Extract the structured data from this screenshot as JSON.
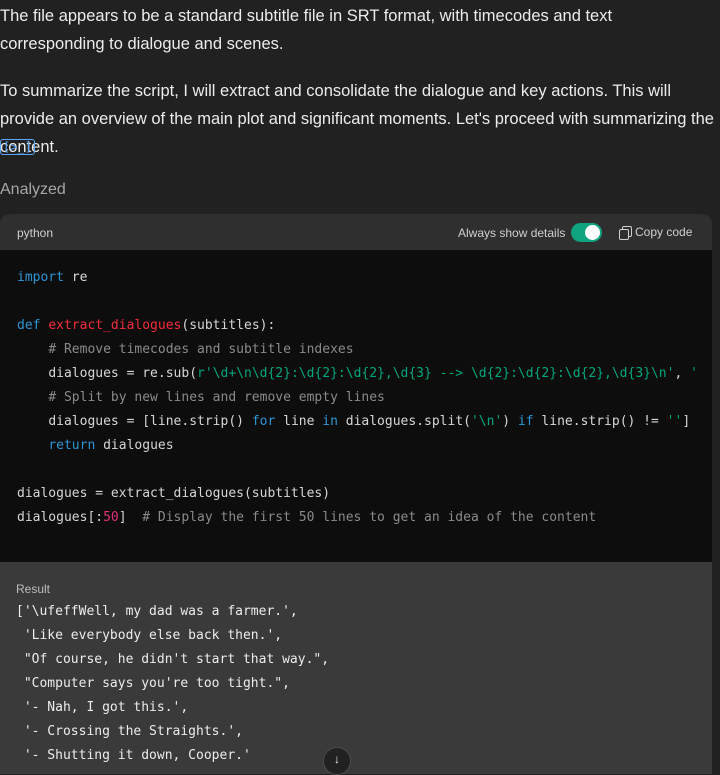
{
  "message": {
    "paragraph_1": "The file appears to be a standard subtitle file in SRT format, with timecodes and text corresponding to dialogue and scenes.",
    "paragraph_2": "To summarize the script, I will extract and consolidate the dialogue and key actions. This will provide an overview of the main plot and significant moments. Let's proceed with summarizing the content.",
    "snippet_icon": "[>_]",
    "status": "Analyzed"
  },
  "code_block": {
    "language": "python",
    "always_show_details": "Always show details",
    "toggle_on": true,
    "copy_label": "Copy code",
    "lines": {
      "l1_kw": "import",
      "l1_rest": " re",
      "l3_kw": "def",
      "l3_fn": "extract_dialogues",
      "l3_rest": "(subtitles):",
      "l4_comment": "# Remove timecodes and subtitle indexes",
      "l5_a": "dialogues = re.sub(",
      "l5_str": "r'\\d+\\n\\d{2}:\\d{2}:\\d{2},\\d{3} --> \\d{2}:\\d{2}:\\d{2},\\d{3}\\n'",
      "l5_b": ", ",
      "l5_str2": "'",
      "l6_comment": "# Split by new lines and remove empty lines",
      "l7_a": "dialogues = [line.strip() ",
      "l7_for": "for",
      "l7_b": " line ",
      "l7_in": "in",
      "l7_c": " dialogues.split(",
      "l7_str": "'\\n'",
      "l7_d": ") ",
      "l7_if": "if",
      "l7_e": " line.strip() != ",
      "l7_str2": "''",
      "l7_f": "]",
      "l8_kw": "return",
      "l8_rest": " dialogues",
      "l10": "dialogues = extract_dialogues(subtitles)",
      "l11_a": "dialogues[:",
      "l11_num": "50",
      "l11_b": "]  ",
      "l11_comment": "# Display the first 50 lines to get an idea of the content"
    }
  },
  "result": {
    "label": "Result",
    "lines": [
      "['\\ufeffWell, my dad was a farmer.',",
      " 'Like everybody else back then.',",
      " \"Of course, he didn't start that way.\",",
      " \"Computer says you're too tight.\",",
      " '- Nah, I got this.',",
      " '- Crossing the Straights.',",
      " '- Shutting it down, Cooper.'"
    ]
  },
  "scroll_down_icon": "arrow-down"
}
